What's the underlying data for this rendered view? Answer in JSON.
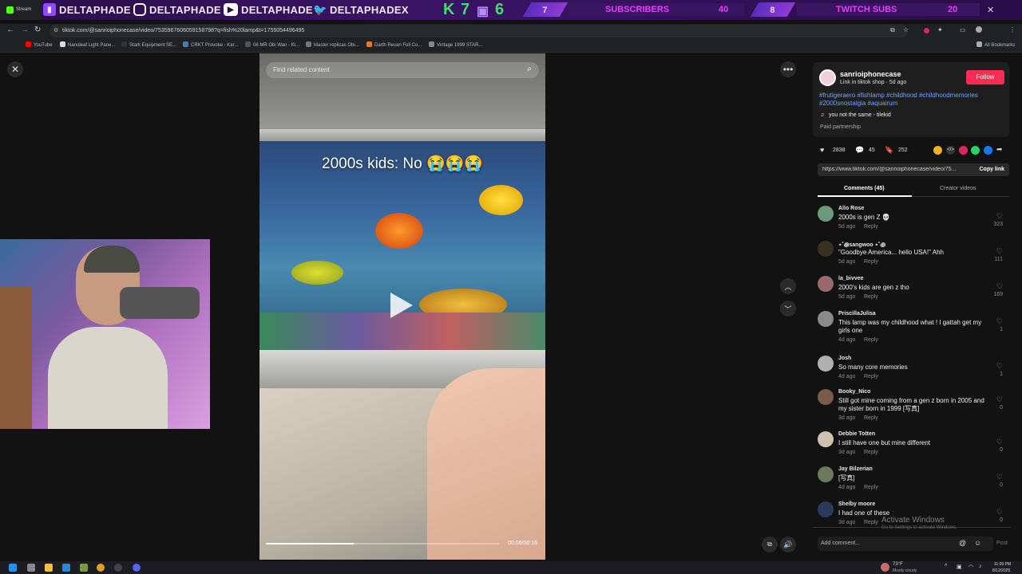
{
  "overlay": {
    "handles": [
      {
        "name": "DELTAPHADE",
        "icon": "twitch-icon"
      },
      {
        "name": "DELTAPHADE",
        "icon": "instagram-icon"
      },
      {
        "name": "DELTAPHADE",
        "icon": "youtube-icon"
      },
      {
        "name": "DELTAPHADEX",
        "icon": "twitter-icon"
      }
    ],
    "kick_count": "7",
    "twitch_count": "6",
    "subs": {
      "current": "7",
      "label": "SUBSCRIBERS",
      "goal": "40"
    },
    "twitch_subs": {
      "current": "8",
      "label": "TWITCH SUBS",
      "goal": "20"
    },
    "tab_label": "Stream"
  },
  "browser": {
    "url": "tiktok.com/@sanrioiphonecase/video/7535967606059158798?q=fish%20lamp&t=1755054496495",
    "bookmarks": [
      "YouTube",
      "Nanoleaf Light Pane...",
      "Stark Equipment SE...",
      "CRKT Provoke - Kar...",
      "06 MR Obi Wan - Ki...",
      "Master replicas Obi...",
      "Darth Revan Full Co...",
      "Vintage 1999 STAR..."
    ],
    "all_bookmarks": "All Bookmarks"
  },
  "video": {
    "search_placeholder": "Find related content",
    "caption": "2000s kids: No 😭😭😭",
    "time": "00:06/00:16",
    "progress": 0.375
  },
  "post": {
    "username": "sanrioiphonecase",
    "sub": "Link in tiktok shop · 5d ago",
    "follow": "Follow",
    "hashtags": "#frutigeraero #fishlamp #childhood #childhoodmemories #2000snostalgia #aquairum",
    "sound": "you not the same - tilekid",
    "paid": "Paid partnership",
    "likes": "2838",
    "comments": "45",
    "saves": "252",
    "link": "https://www.tiktok.com/@sanrioiphonecase/video/75...",
    "copy": "Copy link",
    "tab_comments": "Comments (45)",
    "tab_creator": "Creator videos"
  },
  "comments": [
    {
      "name": "Allo Rose",
      "text": "2000s is gen Z 💀",
      "meta": "5d ago",
      "reply": "Reply",
      "count": "323",
      "color": "#6a9a7a"
    },
    {
      "name": "⋆˚꩜sangwoo ⋆˚꩜",
      "text": "\"Goodbye America... hello USA!\" Ahh",
      "meta": "5d ago",
      "reply": "Reply",
      "count": "111",
      "color": "#3a3020"
    },
    {
      "name": "la_bivvee",
      "text": "2000's kids are gen z tho",
      "meta": "5d ago",
      "reply": "Reply",
      "count": "169",
      "color": "#9a6a6a"
    },
    {
      "name": "PriscillaJulisa",
      "text": "This lamp was my childhood what ! I gattah get my girls one",
      "meta": "4d ago",
      "reply": "Reply",
      "count": "1",
      "color": "#8a8a8a"
    },
    {
      "name": "Josh",
      "text": "So many core memories",
      "meta": "4d ago",
      "reply": "Reply",
      "count": "1",
      "color": "#b0b0b0"
    },
    {
      "name": "Booky_Nico",
      "text": "Still got mine coming from a gen z born in 2005 and my sister born in 1999 [写真]",
      "meta": "3d ago",
      "reply": "Reply",
      "count": "0",
      "color": "#7a5a4a"
    },
    {
      "name": "Debbie Totten",
      "text": "I still have one but mine different",
      "meta": "3d ago",
      "reply": "Reply",
      "count": "0",
      "color": "#d0c0b0"
    },
    {
      "name": "Jay Bilzerian",
      "text": "[写真]",
      "meta": "4d ago",
      "reply": "Reply",
      "count": "0",
      "color": "#6a7a5a"
    },
    {
      "name": "Shelby moore",
      "text": "I had one of these",
      "meta": "3d ago",
      "reply": "Reply",
      "count": "0",
      "color": "#2a3a5a"
    }
  ],
  "add_comment": "Add comment...",
  "post_btn": "Post",
  "activate": {
    "title": "Activate Windows",
    "sub": "Go to Settings to activate Windows."
  },
  "taskbar": {
    "weather": "73°F",
    "weather_sub": "Mostly cloudy",
    "time": "11:09 PM",
    "date": "8/12/2025"
  }
}
